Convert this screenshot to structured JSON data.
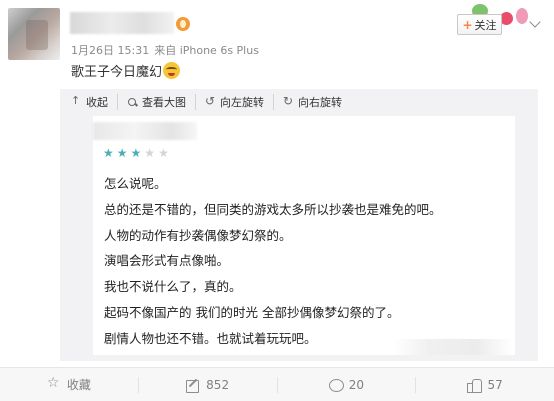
{
  "post": {
    "meta_date": "1月26日 15:31",
    "meta_source": "来自 iPhone 6s Plus",
    "text": "歌王子今日魔幻",
    "emoji_icon": "smile-emoji-icon"
  },
  "header": {
    "follow_label": "关注"
  },
  "image_toolbar": {
    "collapse": "收起",
    "view_large": "查看大图",
    "rotate_left": "向左旋转",
    "rotate_right": "向右旋转"
  },
  "review": {
    "rating": 3,
    "max_rating": 5,
    "star_color": "#4bb0b6",
    "lines": [
      "怎么说呢。",
      "总的还是不错的，但同类的游戏太多所以抄袭也是难免的吧。",
      "人物的动作有抄袭偶像梦幻祭的。",
      "演唱会形式有点像啪。",
      "我也不说什么了，真的。",
      "起码不像国产的 我们的时光 全部抄偶像梦幻祭的了。",
      "剧情人物也还不错。也就试着玩玩吧。"
    ]
  },
  "footer": {
    "favorite_label": "收藏",
    "repost_count": "852",
    "comment_count": "20",
    "like_count": "57"
  },
  "colors": {
    "accent_orange": "#ff8140",
    "media_bg": "#f2f2f5"
  }
}
